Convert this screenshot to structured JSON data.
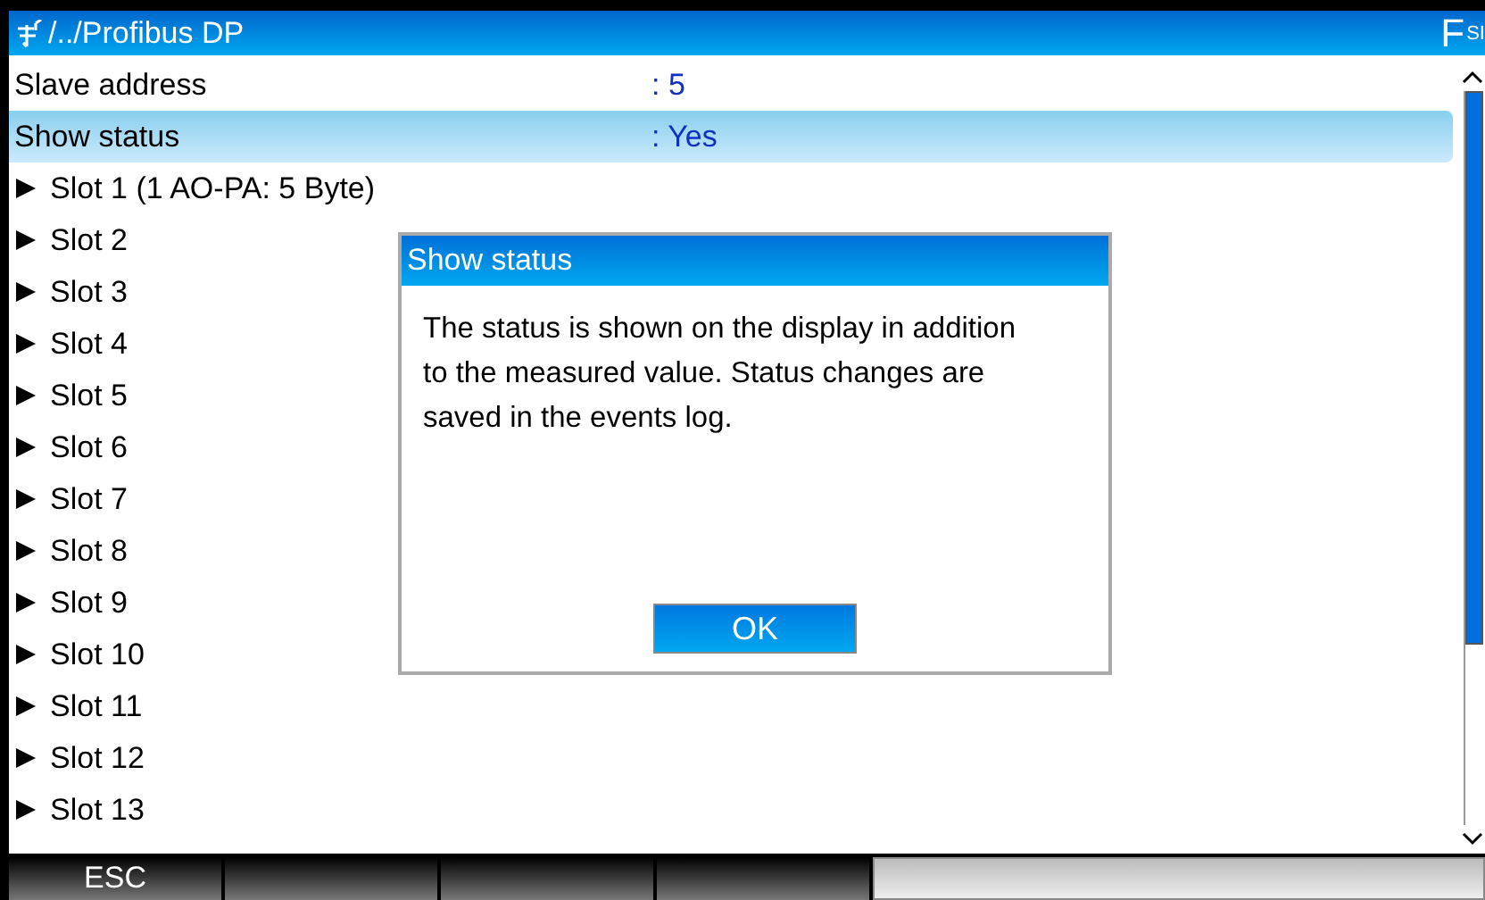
{
  "title_bar": {
    "path": "/../Profibus DP",
    "brand_large": "F",
    "brand_small": "SI"
  },
  "rows": [
    {
      "kind": "value",
      "label": "Slave address",
      "value": ": 5",
      "selected": false
    },
    {
      "kind": "value",
      "label": "Show status",
      "value": ": Yes",
      "selected": true
    },
    {
      "kind": "slot",
      "label": "Slot 1 (1 AO-PA: 5 Byte)",
      "selected": false
    },
    {
      "kind": "slot",
      "label": "Slot 2",
      "selected": false
    },
    {
      "kind": "slot",
      "label": "Slot 3",
      "selected": false
    },
    {
      "kind": "slot",
      "label": "Slot 4",
      "selected": false
    },
    {
      "kind": "slot",
      "label": "Slot 5",
      "selected": false
    },
    {
      "kind": "slot",
      "label": "Slot 6",
      "selected": false
    },
    {
      "kind": "slot",
      "label": "Slot 7",
      "selected": false
    },
    {
      "kind": "slot",
      "label": "Slot 8",
      "selected": false
    },
    {
      "kind": "slot",
      "label": "Slot 9",
      "selected": false
    },
    {
      "kind": "slot",
      "label": "Slot 10",
      "selected": false
    },
    {
      "kind": "slot",
      "label": "Slot 11",
      "selected": false
    },
    {
      "kind": "slot",
      "label": "Slot 12",
      "selected": false
    },
    {
      "kind": "slot",
      "label": "Slot 13",
      "selected": false
    }
  ],
  "dialog": {
    "title": "Show status",
    "text": "The status is shown on the display in addition to the measured value. Status changes are saved in the events log.",
    "button": "OK"
  },
  "softkeys": [
    {
      "kind": "key",
      "label": "ESC"
    },
    {
      "kind": "blank"
    },
    {
      "kind": "blank"
    },
    {
      "kind": "blank"
    }
  ]
}
